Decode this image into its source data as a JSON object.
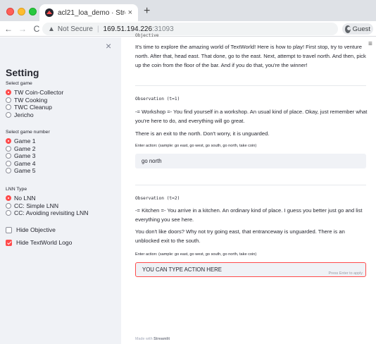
{
  "browser": {
    "tab_title": "acl21_loa_demo · Streamlit",
    "tab_close": "×",
    "new_tab": "+",
    "back": "←",
    "forward": "→",
    "reload": "C",
    "security_warning": "Not Secure",
    "url_host": "169.51.194.226",
    "url_port": ":31093",
    "profile_label": "Guest",
    "menu": "⋮"
  },
  "sidebar": {
    "close": "×",
    "title": "Setting",
    "game_group": {
      "label": "Select game",
      "options": [
        "TW Coin-Collector",
        "TW Cooking",
        "TWC Cleanup",
        "Jericho"
      ],
      "selected_index": 0
    },
    "game_number_group": {
      "label": "Select game number",
      "options": [
        "Game 1",
        "Game 2",
        "Game 3",
        "Game 4",
        "Game 5"
      ],
      "selected_index": 0
    },
    "lnn_group": {
      "label": "LNN Type",
      "options": [
        "No LNN",
        "CC: Simple LNN",
        "CC: Avoiding revisiting LNN"
      ],
      "selected_index": 0
    },
    "checkboxes": [
      {
        "label": "Hide Objective",
        "checked": false
      },
      {
        "label": "Hide TextWorld Logo",
        "checked": true
      }
    ]
  },
  "main": {
    "hamburger": "≡",
    "cut_label": "Objective",
    "intro": "It's time to explore the amazing world of TextWorld! Here is how to play! First stop, try to venture north. After that, head east. That done, go to the east. Next, attempt to travel north. And then, pick up the coin from the floor of the bar. And if you do that, you're the winner!",
    "observations": [
      {
        "label": "Observation (t=1)",
        "paragraphs": [
          "-= Workshop =- You find yourself in a workshop. An usual kind of place. Okay, just remember what you're here to do, and everything will go great.",
          "There is an exit to the north. Don't worry, it is unguarded."
        ],
        "input_label": "Enter action: (sample: go east, go west, go south, go north, take coin)",
        "input_value": "go north"
      },
      {
        "label": "Observation (t=2)",
        "paragraphs": [
          "-= Kitchen =- You arrive in a kitchen. An ordinary kind of place. I guess you better just go and list everything you see here.",
          "You don't like doors? Why not try going east, that entranceway is unguarded. There is an unblocked exit to the south."
        ],
        "input_label": "Enter action: (sample: go east, go west, go south, go north, take coin)",
        "input_value": "YOU CAN TYPE ACTION HERE",
        "input_hint": "Press Enter to apply"
      }
    ],
    "footer_prefix": "Made with ",
    "footer_brand": "Streamlit"
  },
  "colors": {
    "accent": "#ff4b4b",
    "sidebar_bg": "#f0f2f6",
    "text": "#262730"
  },
  "icons": {
    "tab_favicon": "streamlit-icon",
    "security": "warning-triangle-icon",
    "profile": "guest-avatar-icon"
  }
}
